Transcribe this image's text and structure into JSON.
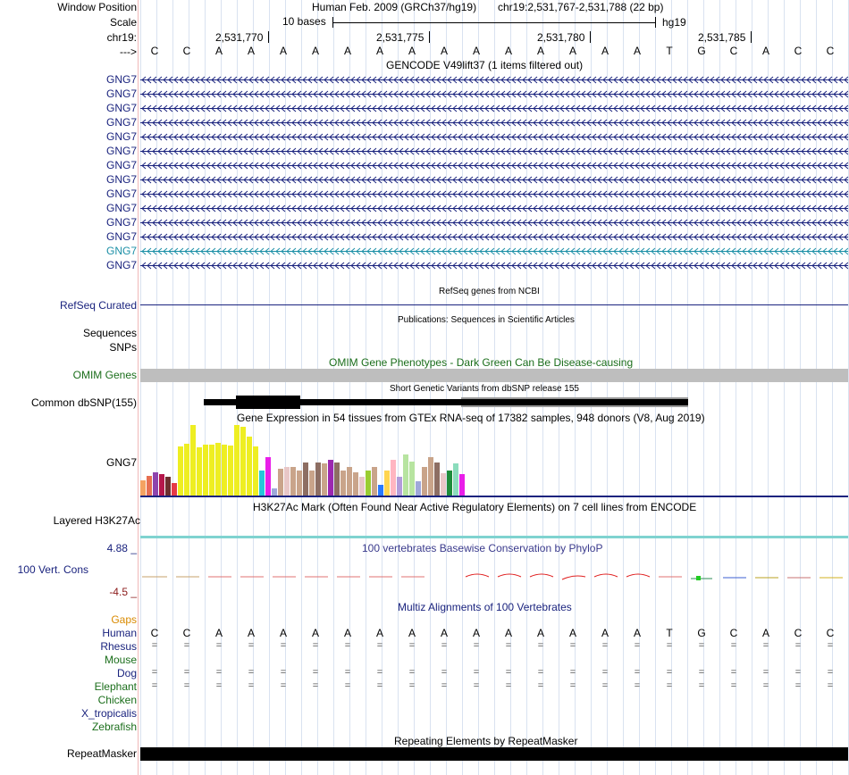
{
  "header": {
    "window_position_label": "Window Position",
    "assembly_text": "Human Feb. 2009 (GRCh37/hg19)",
    "position_text": "chr19:2,531,767-2,531,788 (22 bp)",
    "scale_label": "Scale",
    "scale_text": "10 bases",
    "scale_db": "hg19",
    "chrom_label": "chr19:",
    "ticks": [
      "2,531,770",
      "2,531,775",
      "2,531,780",
      "2,531,785"
    ],
    "strand_label": "--->"
  },
  "bases": [
    "C",
    "C",
    "A",
    "A",
    "A",
    "A",
    "A",
    "A",
    "A",
    "A",
    "A",
    "A",
    "A",
    "A",
    "A",
    "A",
    "T",
    "G",
    "C",
    "A",
    "C",
    "C"
  ],
  "tracks": {
    "gencode": {
      "title": "GENCODE V49lift37 (1 items filtered out)",
      "genes": [
        "GNG7",
        "GNG7",
        "GNG7",
        "GNG7",
        "GNG7",
        "GNG7",
        "GNG7",
        "GNG7",
        "GNG7",
        "GNG7",
        "GNG7",
        "GNG7",
        "GNG7",
        "GNG7"
      ],
      "highlight_index": 12
    },
    "refseq": {
      "title": "RefSeq genes from NCBI",
      "label": "RefSeq Curated"
    },
    "publications": {
      "title": "Publications: Sequences in Scientific Articles",
      "label": "Sequences"
    },
    "snps_label": "SNPs",
    "omim": {
      "title": "OMIM Gene Phenotypes - Dark Green Can Be Disease-causing",
      "label": "OMIM Genes"
    },
    "dbsnp": {
      "title": "Short Genetic Variants from dbSNP release 155",
      "label": "Common dbSNP(155)"
    },
    "gtex": {
      "title": "Gene Expression in 54 tissues from GTEx RNA-seq of 17382 samples, 948 donors (V8, Aug 2019)",
      "label": "GNG7"
    },
    "h3k27ac": {
      "title": "H3K27Ac Mark (Often Found Near Active Regulatory Elements) on 7 cell lines from ENCODE",
      "label": "Layered H3K27Ac"
    },
    "phylop": {
      "title": "100 vertebrates Basewise Conservation by PhyloP",
      "label": "100 Vert. Cons",
      "max": "4.88 _",
      "min": "-4.5 _"
    },
    "multiz": {
      "title": "Multiz Alignments of 100 Vertebrates",
      "species": [
        "Gaps",
        "Human",
        "Rhesus",
        "Mouse",
        "Dog",
        "Elephant",
        "Chicken",
        "X_tropicalis",
        "Zebrafish"
      ]
    },
    "repeatmasker": {
      "title": "Repeating Elements by RepeatMasker",
      "label": "RepeatMasker"
    }
  },
  "colors": {
    "navy": "#1a237e",
    "gene_highlight": "#1b8fa6",
    "omim_grey": "#bebebe",
    "gaps_orange": "#d98a00",
    "species_green": "#1b6e1b",
    "phylop_max": "#1a237e",
    "phylop_min": "#8b1a1a"
  },
  "gtex_bars": [
    {
      "h": 0.22,
      "c": "#f4a261"
    },
    {
      "h": 0.28,
      "c": "#e76f51"
    },
    {
      "h": 0.33,
      "c": "#8e44ad"
    },
    {
      "h": 0.3,
      "c": "#b5174b"
    },
    {
      "h": 0.26,
      "c": "#6d2f2f"
    },
    {
      "h": 0.18,
      "c": "#e63946"
    },
    {
      "h": 0.7,
      "c": "#eeee22"
    },
    {
      "h": 0.73,
      "c": "#eeee22"
    },
    {
      "h": 1.0,
      "c": "#eeee22"
    },
    {
      "h": 0.68,
      "c": "#eeee22"
    },
    {
      "h": 0.72,
      "c": "#eeee22"
    },
    {
      "h": 0.72,
      "c": "#eeee22"
    },
    {
      "h": 0.75,
      "c": "#eeee22"
    },
    {
      "h": 0.72,
      "c": "#eeee22"
    },
    {
      "h": 0.71,
      "c": "#eeee22"
    },
    {
      "h": 1.0,
      "c": "#eeee22"
    },
    {
      "h": 0.98,
      "c": "#eeee22"
    },
    {
      "h": 0.84,
      "c": "#eeee22"
    },
    {
      "h": 0.7,
      "c": "#eeee22"
    },
    {
      "h": 0.35,
      "c": "#26c6da"
    },
    {
      "h": 0.55,
      "c": "#e91ee9"
    },
    {
      "h": 0.1,
      "c": "#9fa8da"
    },
    {
      "h": 0.38,
      "c": "#c9a48a"
    },
    {
      "h": 0.4,
      "c": "#e8c7c7"
    },
    {
      "h": 0.4,
      "c": "#c9a48a"
    },
    {
      "h": 0.36,
      "c": "#c9a48a"
    },
    {
      "h": 0.47,
      "c": "#8d6e63"
    },
    {
      "h": 0.36,
      "c": "#c9a48a"
    },
    {
      "h": 0.47,
      "c": "#8d6e63"
    },
    {
      "h": 0.45,
      "c": "#c9a48a"
    },
    {
      "h": 0.5,
      "c": "#9c27b0"
    },
    {
      "h": 0.47,
      "c": "#8d6e63"
    },
    {
      "h": 0.36,
      "c": "#c9a48a"
    },
    {
      "h": 0.4,
      "c": "#c9a48a"
    },
    {
      "h": 0.33,
      "c": "#c9a48a"
    },
    {
      "h": 0.27,
      "c": "#e8c7c7"
    },
    {
      "h": 0.35,
      "c": "#9acd32"
    },
    {
      "h": 0.4,
      "c": "#c9a48a"
    },
    {
      "h": 0.15,
      "c": "#2979ff"
    },
    {
      "h": 0.35,
      "c": "#ffd54f"
    },
    {
      "h": 0.5,
      "c": "#ffb6c1"
    },
    {
      "h": 0.27,
      "c": "#b39ddb"
    },
    {
      "h": 0.58,
      "c": "#b7e4a0"
    },
    {
      "h": 0.48,
      "c": "#b7e4a0"
    },
    {
      "h": 0.2,
      "c": "#9fa8da"
    },
    {
      "h": 0.4,
      "c": "#c9a48a"
    },
    {
      "h": 0.55,
      "c": "#c9a48a"
    },
    {
      "h": 0.47,
      "c": "#8d6e63"
    },
    {
      "h": 0.32,
      "c": "#e8c7c7"
    },
    {
      "h": 0.35,
      "c": "#1e8c3a"
    },
    {
      "h": 0.45,
      "c": "#8bdcbc"
    },
    {
      "h": 0.3,
      "c": "#e91ee9"
    }
  ]
}
